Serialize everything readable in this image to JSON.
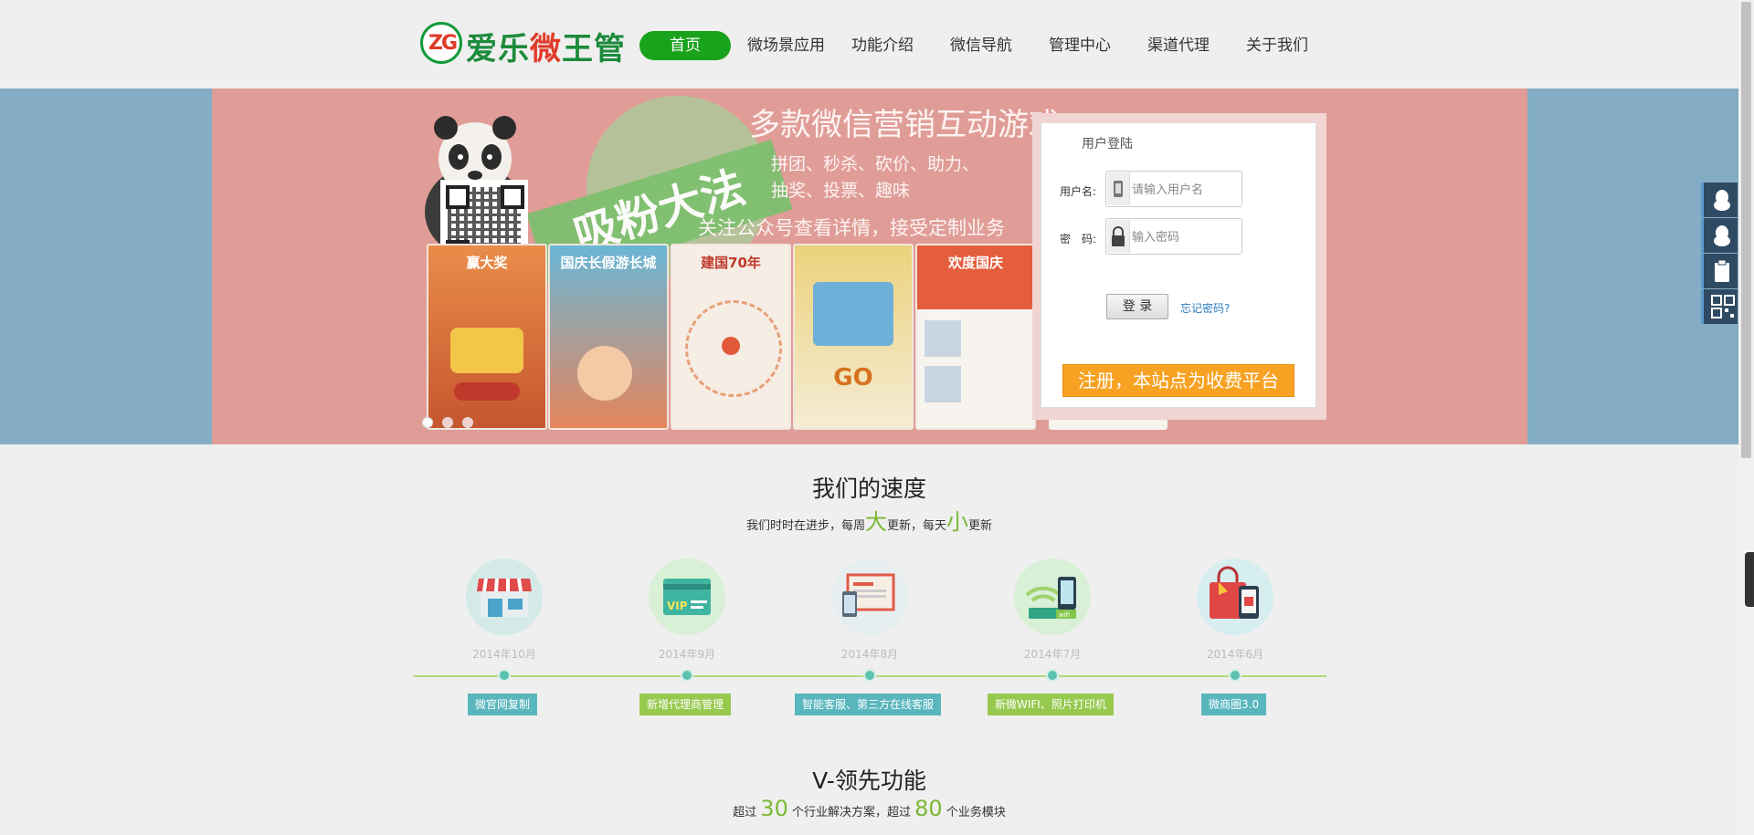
{
  "header": {
    "logo_mark": "ZG",
    "logo_text_a": "爱乐",
    "logo_text_b": "微",
    "logo_text_c": "王管",
    "nav": [
      {
        "label": "首页",
        "active": true
      },
      {
        "label": "微场景应用"
      },
      {
        "label": "功能介绍"
      },
      {
        "label": "微信导航"
      },
      {
        "label": "管理中心"
      },
      {
        "label": "渠道代理"
      },
      {
        "label": "关于我们"
      }
    ]
  },
  "banner": {
    "title": "多款微信营销互动游戏",
    "line1": "拼团、秒杀、砍价、助力、",
    "line2": "抽奖、投票、趣味",
    "follow": "关注公众号查看详情，接受定制业务",
    "slogan": "吸粉大法",
    "cards": [
      "赢大奖",
      "国庆长假游长城",
      "建国70年",
      "GO",
      "欢度国庆"
    ],
    "slide_count": 3,
    "active_slide": 1
  },
  "login": {
    "title": "用户登陆",
    "username_label": "用户名:",
    "username_placeholder": "请输入用户名",
    "password_label": "密　码:",
    "password_placeholder": "输入密码",
    "login_button": "登 录",
    "forgot_link": "忘记密码?",
    "register_button": "注册，本站点为收费平台"
  },
  "side_float": [
    "qq-icon",
    "qq-icon",
    "clipboard-icon",
    "qrcode-icon"
  ],
  "speed": {
    "title": "我们的速度",
    "sub_a": "我们时时在进步，每周",
    "sub_big1": "大",
    "sub_b": "更新，每天",
    "sub_big2": "小",
    "sub_c": "更新",
    "items": [
      {
        "date": "2014年10月",
        "tag": "微官网复制",
        "tag_color": "#5ab6bd",
        "icon": "store-icon"
      },
      {
        "date": "2014年9月",
        "tag": "新增代理商管理",
        "tag_color": "#96c94e",
        "icon": "vip-card-icon"
      },
      {
        "date": "2014年8月",
        "tag": "智能客服、第三方在线客服",
        "tag_color": "#5ab6bd",
        "icon": "devices-icon"
      },
      {
        "date": "2014年7月",
        "tag": "新微WIFI、照片打印机",
        "tag_color": "#96c94e",
        "icon": "wifi-router-icon"
      },
      {
        "date": "2014年6月",
        "tag": "微商圈3.0",
        "tag_color": "#5ab6bd",
        "icon": "shopping-bag-icon"
      }
    ]
  },
  "features": {
    "title": "V-领先功能",
    "sub_a": "超过",
    "num1": "30",
    "sub_b": "个行业解决方案，超过",
    "num2": "80",
    "sub_c": "个业务模块"
  }
}
